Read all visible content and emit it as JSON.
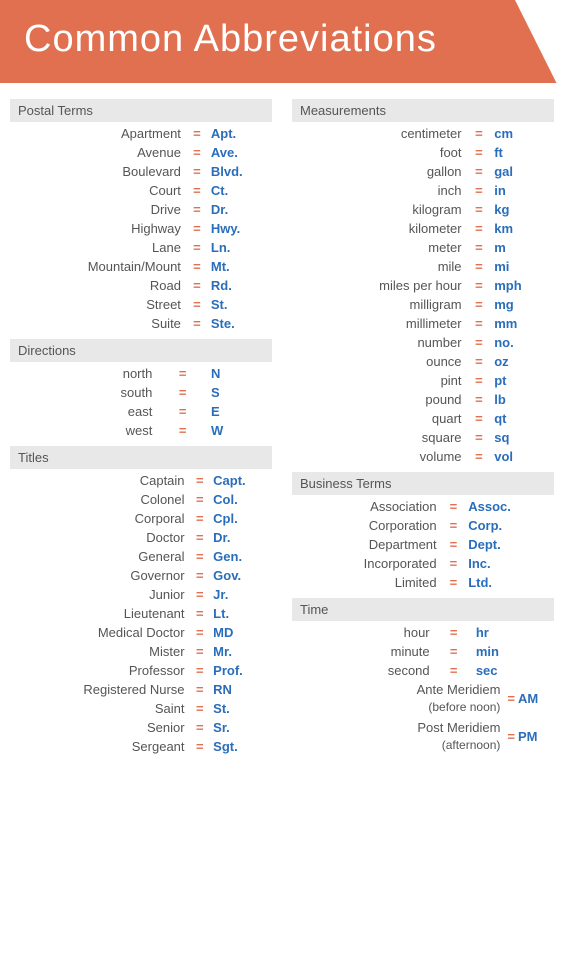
{
  "header": {
    "title": "Common Abbreviations"
  },
  "left": {
    "sections": [
      {
        "id": "postal",
        "header": "Postal Terms",
        "rows": [
          {
            "term": "Apartment",
            "abbr": "Apt."
          },
          {
            "term": "Avenue",
            "abbr": "Ave."
          },
          {
            "term": "Boulevard",
            "abbr": "Blvd."
          },
          {
            "term": "Court",
            "abbr": "Ct."
          },
          {
            "term": "Drive",
            "abbr": "Dr."
          },
          {
            "term": "Highway",
            "abbr": "Hwy."
          },
          {
            "term": "Lane",
            "abbr": "Ln."
          },
          {
            "term": "Mountain/Mount",
            "abbr": "Mt."
          },
          {
            "term": "Road",
            "abbr": "Rd."
          },
          {
            "term": "Street",
            "abbr": "St."
          },
          {
            "term": "Suite",
            "abbr": "Ste."
          }
        ]
      },
      {
        "id": "directions",
        "header": "Directions",
        "rows": [
          {
            "term": "north",
            "abbr": "N"
          },
          {
            "term": "south",
            "abbr": "S"
          },
          {
            "term": "east",
            "abbr": "E"
          },
          {
            "term": "west",
            "abbr": "W"
          }
        ]
      },
      {
        "id": "titles",
        "header": "Titles",
        "rows": [
          {
            "term": "Captain",
            "abbr": "Capt."
          },
          {
            "term": "Colonel",
            "abbr": "Col."
          },
          {
            "term": "Corporal",
            "abbr": "Cpl."
          },
          {
            "term": "Doctor",
            "abbr": "Dr."
          },
          {
            "term": "General",
            "abbr": "Gen."
          },
          {
            "term": "Governor",
            "abbr": "Gov."
          },
          {
            "term": "Junior",
            "abbr": "Jr."
          },
          {
            "term": "Lieutenant",
            "abbr": "Lt."
          },
          {
            "term": "Medical Doctor",
            "abbr": "MD"
          },
          {
            "term": "Mister",
            "abbr": "Mr."
          },
          {
            "term": "Professor",
            "abbr": "Prof."
          },
          {
            "term": "Registered Nurse",
            "abbr": "RN"
          },
          {
            "term": "Saint",
            "abbr": "St."
          },
          {
            "term": "Senior",
            "abbr": "Sr."
          },
          {
            "term": "Sergeant",
            "abbr": "Sgt."
          }
        ]
      }
    ]
  },
  "right": {
    "sections": [
      {
        "id": "measurements",
        "header": "Measurements",
        "rows": [
          {
            "term": "centimeter",
            "abbr": "cm"
          },
          {
            "term": "foot",
            "abbr": "ft"
          },
          {
            "term": "gallon",
            "abbr": "gal"
          },
          {
            "term": "inch",
            "abbr": "in"
          },
          {
            "term": "kilogram",
            "abbr": "kg"
          },
          {
            "term": "kilometer",
            "abbr": "km"
          },
          {
            "term": "meter",
            "abbr": "m"
          },
          {
            "term": "mile",
            "abbr": "mi"
          },
          {
            "term": "miles per hour",
            "abbr": "mph"
          },
          {
            "term": "milligram",
            "abbr": "mg"
          },
          {
            "term": "millimeter",
            "abbr": "mm"
          },
          {
            "term": "number",
            "abbr": "no."
          },
          {
            "term": "ounce",
            "abbr": "oz"
          },
          {
            "term": "pint",
            "abbr": "pt"
          },
          {
            "term": "pound",
            "abbr": "lb"
          },
          {
            "term": "quart",
            "abbr": "qt"
          },
          {
            "term": "square",
            "abbr": "sq"
          },
          {
            "term": "volume",
            "abbr": "vol"
          }
        ]
      },
      {
        "id": "business",
        "header": "Business Terms",
        "rows": [
          {
            "term": "Association",
            "abbr": "Assoc."
          },
          {
            "term": "Corporation",
            "abbr": "Corp."
          },
          {
            "term": "Department",
            "abbr": "Dept."
          },
          {
            "term": "Incorporated",
            "abbr": "Inc."
          },
          {
            "term": "Limited",
            "abbr": "Ltd."
          }
        ]
      },
      {
        "id": "time",
        "header": "Time",
        "rows": [
          {
            "term": "hour",
            "abbr": "hr"
          },
          {
            "term": "minute",
            "abbr": "min"
          },
          {
            "term": "second",
            "abbr": "sec"
          }
        ],
        "multilineRows": [
          {
            "termLine1": "Ante Meridiem",
            "termLine2": "(before noon)",
            "abbr": "AM"
          },
          {
            "termLine1": "Post Meridiem",
            "termLine2": "(afternoon)",
            "abbr": "PM"
          }
        ]
      }
    ]
  },
  "eq_sign": "=",
  "colors": {
    "header_bg": "#e07050",
    "section_header_bg": "#e8e8e8",
    "term_color": "#555555",
    "eq_color": "#e07050",
    "abbr_color": "#2a6ebb"
  }
}
